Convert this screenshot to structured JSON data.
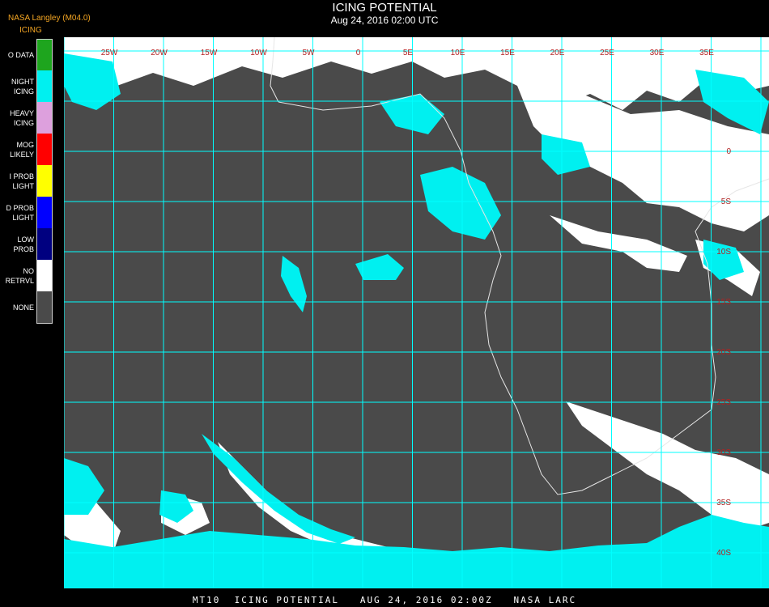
{
  "header": {
    "source": "NASA Langley (M04.0)",
    "product": "ICING",
    "title": "ICING POTENTIAL",
    "subtitle": "Aug 24, 2016 02:00 UTC"
  },
  "legend": {
    "items": [
      {
        "label": "O DATA",
        "color": "#1ea51e"
      },
      {
        "label": "NIGHT\nICING",
        "color": "#00f0f0"
      },
      {
        "label": "HEAVY\nICING",
        "color": "#dda0dd"
      },
      {
        "label": "MOG\nLIKELY",
        "color": "#ff0000"
      },
      {
        "label": "I PROB\nLIGHT",
        "color": "#ffff00"
      },
      {
        "label": "D PROB\nLIGHT",
        "color": "#0000ff"
      },
      {
        "label": "LOW\nPROB",
        "color": "#000080"
      },
      {
        "label": "NO\nRETRVL",
        "color": "#ffffff"
      },
      {
        "label": "NONE",
        "color": "#4a4a4a"
      }
    ]
  },
  "map": {
    "grid_color": "#00ffff",
    "label_color": "#b22222",
    "background_color": "#4a4a4a",
    "top_labels": [
      "25W",
      "20W",
      "15W",
      "10W",
      "5W",
      "0",
      "5E",
      "10E",
      "15E",
      "20E",
      "25E",
      "30E",
      "35E"
    ],
    "right_labels": [
      "0",
      "5S",
      "10S",
      "15S",
      "20S",
      "25S",
      "30S",
      "35S",
      "40S"
    ]
  },
  "footer": {
    "text": "MT10  ICING POTENTIAL   AUG 24, 2016 02:00Z   NASA LARC"
  }
}
